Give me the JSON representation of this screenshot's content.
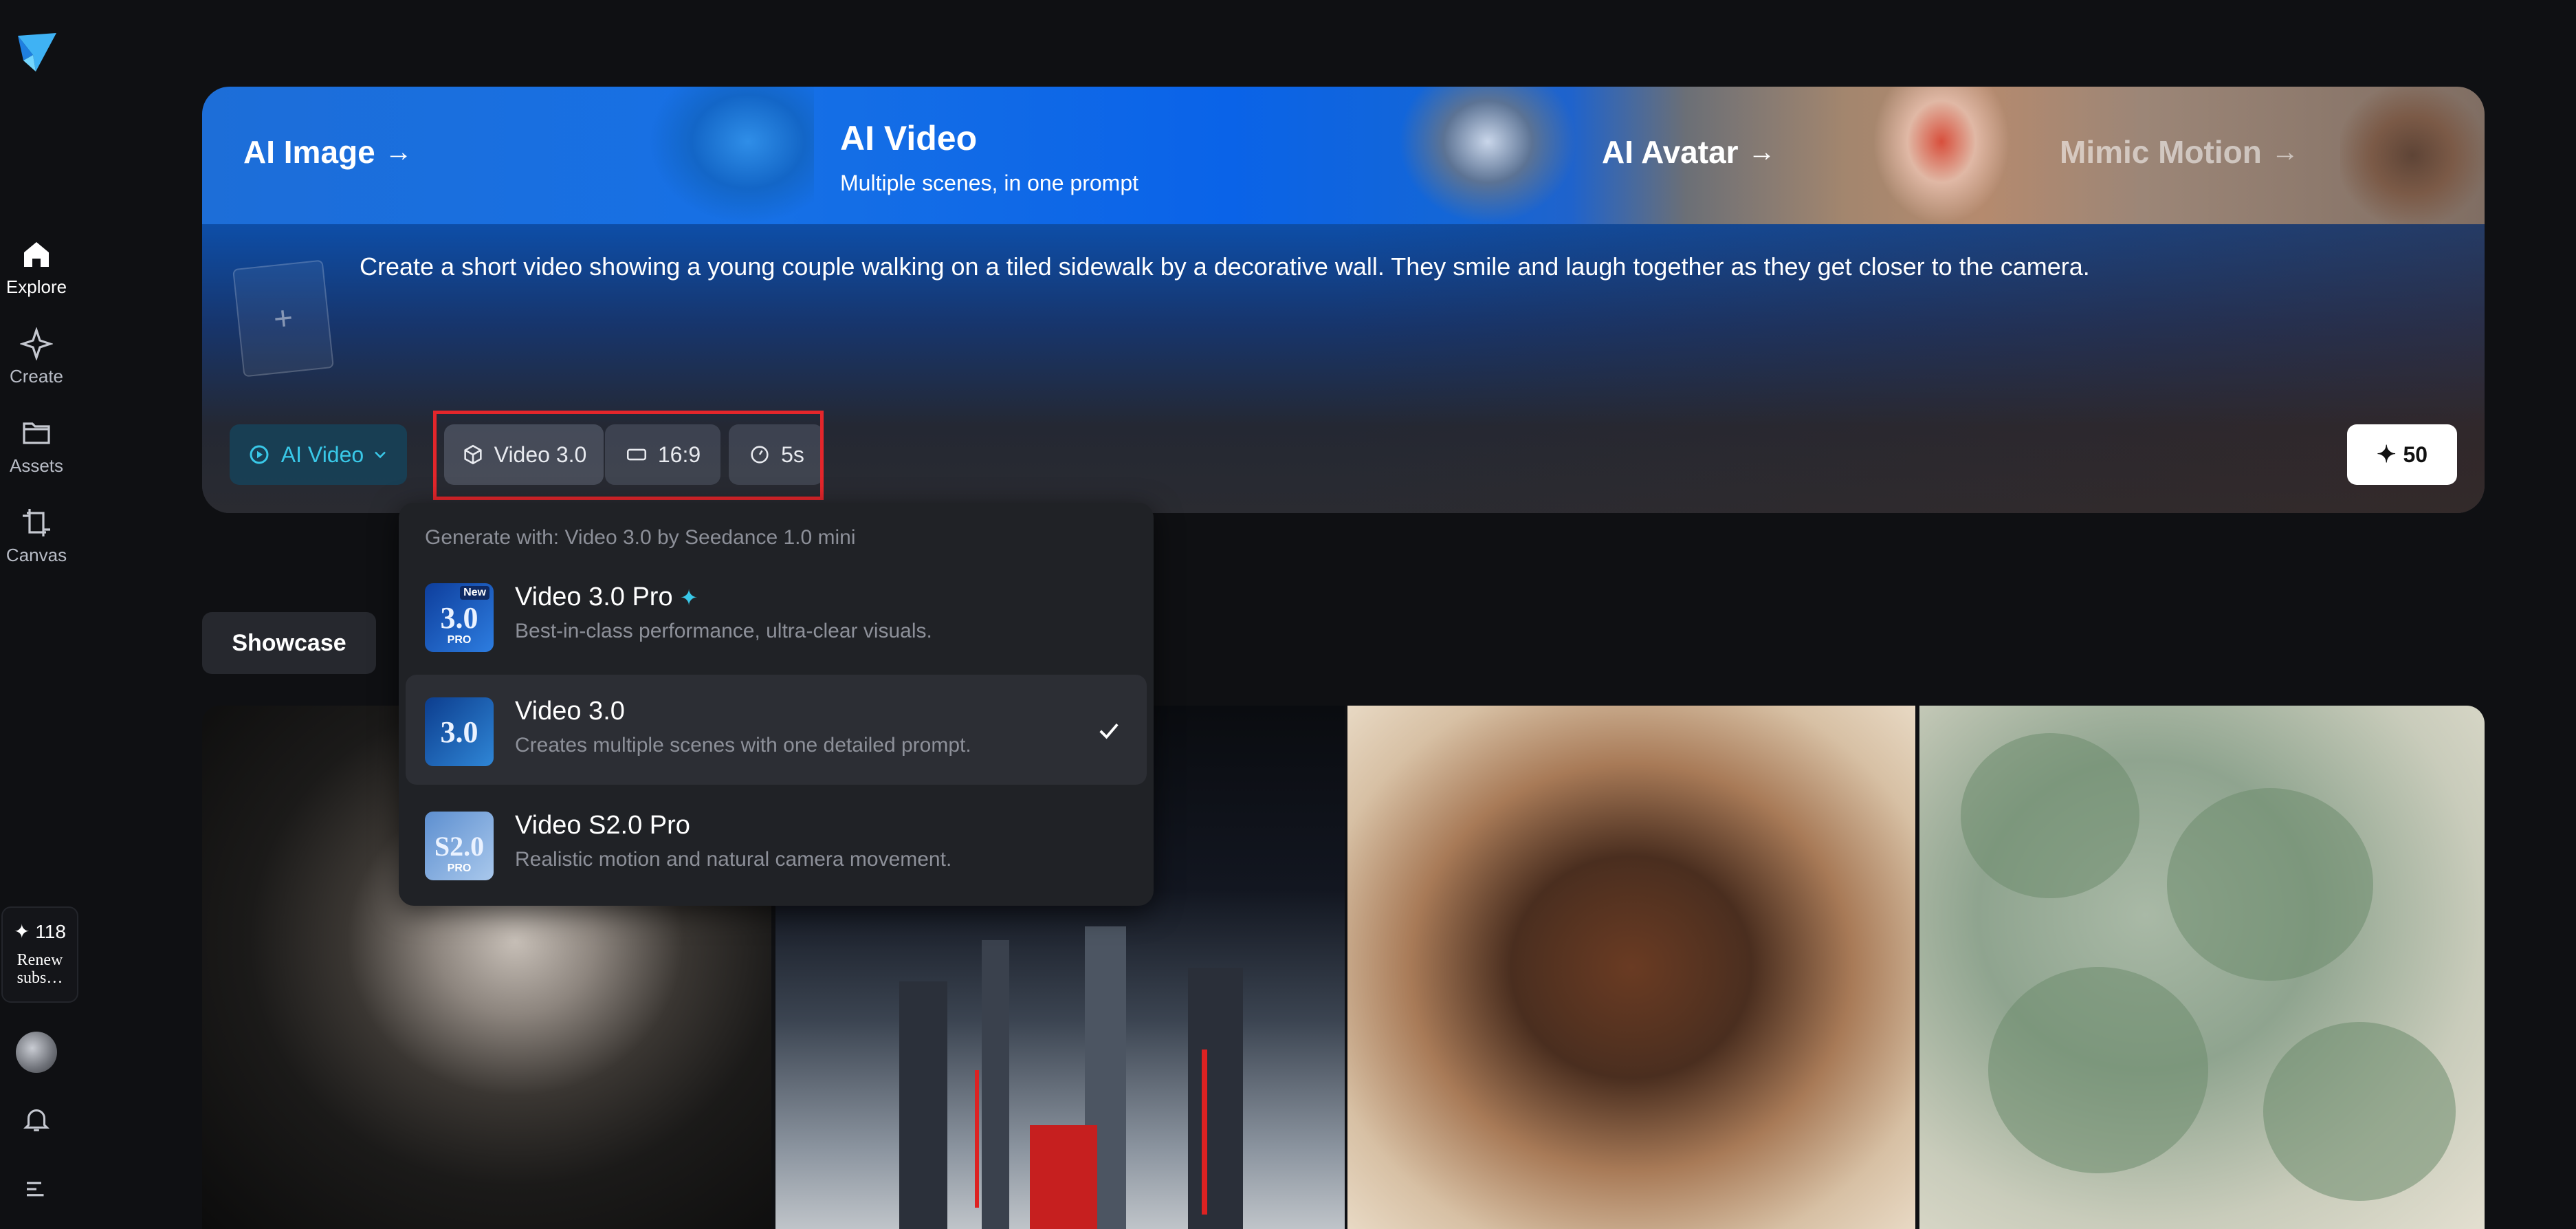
{
  "sidebar": {
    "items": [
      {
        "label": "Explore",
        "icon": "home-icon"
      },
      {
        "label": "Create",
        "icon": "sparkle-icon"
      },
      {
        "label": "Assets",
        "icon": "folder-icon"
      },
      {
        "label": "Canvas",
        "icon": "crop-icon"
      }
    ],
    "credits": "✦ 118",
    "renew": "Renew subs…"
  },
  "hero": {
    "tabs": [
      {
        "label": "AI Image",
        "arrow": "→"
      },
      {
        "label": "AI Video",
        "subtitle": "Multiple scenes, in one prompt"
      },
      {
        "label": "AI Avatar",
        "arrow": "→"
      },
      {
        "label": "Mimic Motion",
        "arrow": "→"
      }
    ],
    "upload_plus": "+",
    "prompt": "Create a short video showing a young couple walking on a tiled sidewalk by a decorative wall. They smile and laugh together as they get closer to the camera.",
    "mode_label": "AI Video",
    "model_label": "Video 3.0",
    "ratio_label": "16:9",
    "duration_label": "5s",
    "cost_label": "50",
    "cost_icon": "sparkle-icon"
  },
  "dropdown": {
    "heading": "Generate with: Video 3.0 by Seedance 1.0 mini",
    "items": [
      {
        "title": "Video 3.0 Pro",
        "desc": "Best-in-class performance, ultra-clear visuals.",
        "thumb": "3.0",
        "badge": "PRO",
        "new": "New",
        "selected": false
      },
      {
        "title": "Video 3.0",
        "desc": "Creates multiple scenes with one detailed prompt.",
        "thumb": "3.0",
        "selected": true
      },
      {
        "title": "Video S2.0 Pro",
        "desc": "Realistic motion and natural camera movement.",
        "thumb": "S2.0",
        "badge": "PRO",
        "selected": false
      }
    ]
  },
  "showcase": {
    "label": "Showcase"
  },
  "colors": {
    "accent": "#39c8e8",
    "highlight": "#e3262b",
    "background": "#0f1013"
  }
}
